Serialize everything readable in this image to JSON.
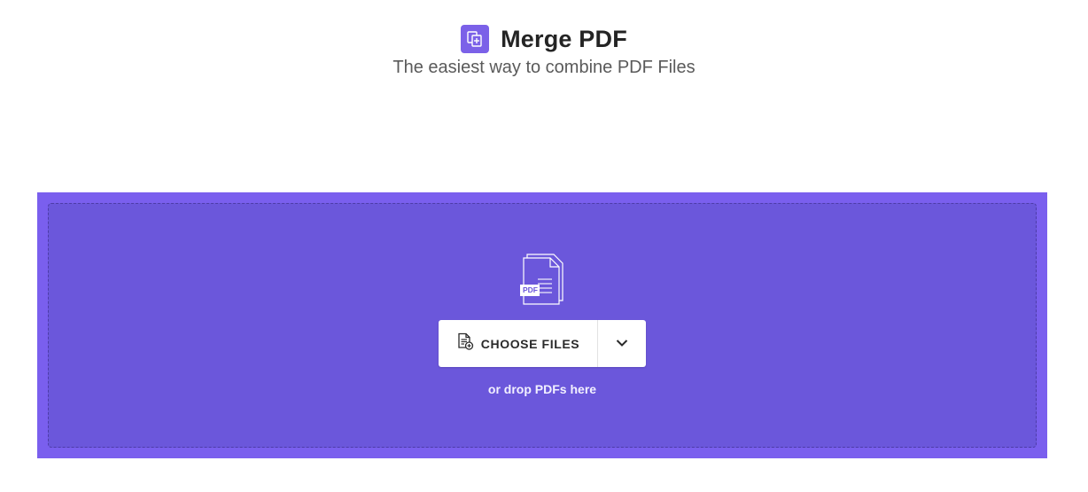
{
  "header": {
    "icon": "merge-pdf-icon",
    "title": "Merge PDF",
    "subtitle": "The easiest way to combine PDF Files"
  },
  "dropzone": {
    "illustration_icon": "pdf-documents-icon",
    "illustration_badge": "PDF",
    "choose_button": {
      "icon": "file-add-icon",
      "label": "CHOOSE FILES"
    },
    "dropdown_icon": "chevron-down-icon",
    "hint": "or drop PDFs here"
  },
  "colors": {
    "accent": "#7b61e8",
    "dropzone_outer": "#7a5fee",
    "dropzone_inner": "#6b57db",
    "title_text": "#242424",
    "subtitle_text": "#5a5a5a"
  }
}
